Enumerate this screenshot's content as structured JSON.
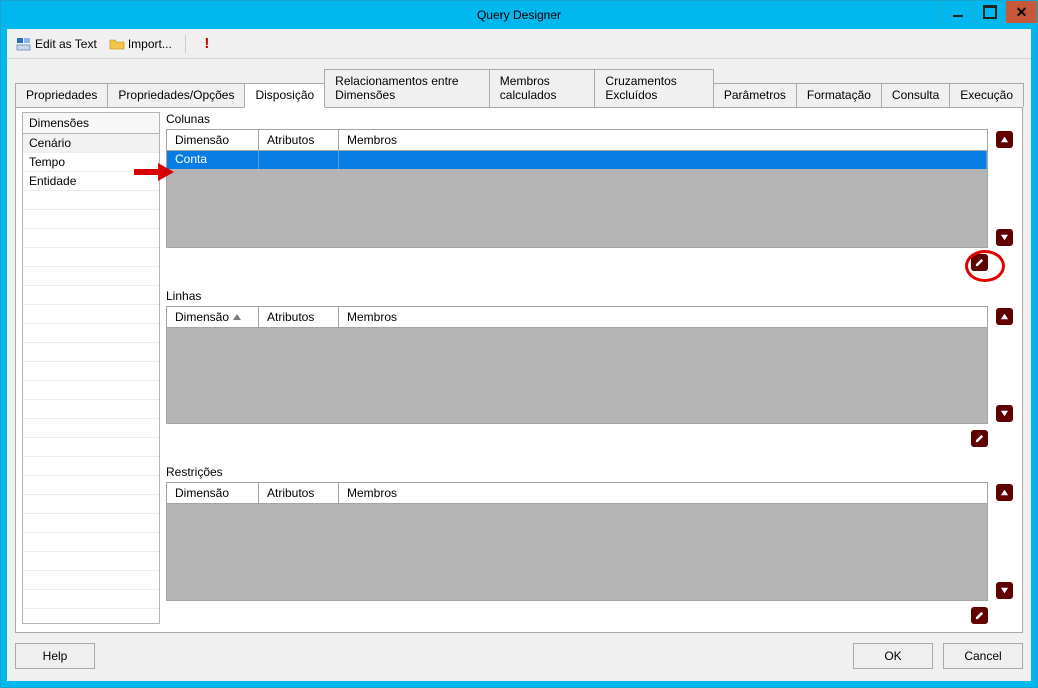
{
  "window": {
    "title": "Query Designer"
  },
  "toolbar": {
    "edit_as_text": "Edit as Text",
    "import": "Import..."
  },
  "tabs": [
    "Propriedades",
    "Propriedades/Opções",
    "Disposição",
    "Relacionamentos entre Dimensões",
    "Membros calculados",
    "Cruzamentos Excluídos",
    "Parâmetros",
    "Formatação",
    "Consulta",
    "Execução"
  ],
  "active_tab_index": 2,
  "dimensions": {
    "header": "Dimensões",
    "items": [
      "Cenário",
      "Tempo",
      "Entidade"
    ]
  },
  "columns": {
    "title": "Colunas",
    "headers": {
      "dim": "Dimensão",
      "attr": "Atributos",
      "mem": "Membros"
    },
    "rows": [
      {
        "dim": "Conta",
        "attr": "",
        "mem": ""
      }
    ],
    "selected_index": 0
  },
  "rows_section": {
    "title": "Linhas",
    "headers": {
      "dim": "Dimensão",
      "attr": "Atributos",
      "mem": "Membros"
    },
    "rows": []
  },
  "restrictions": {
    "title": "Restrições",
    "headers": {
      "dim": "Dimensão",
      "attr": "Atributos",
      "mem": "Membros"
    },
    "rows": []
  },
  "footer": {
    "help": "Help",
    "ok": "OK",
    "cancel": "Cancel"
  }
}
